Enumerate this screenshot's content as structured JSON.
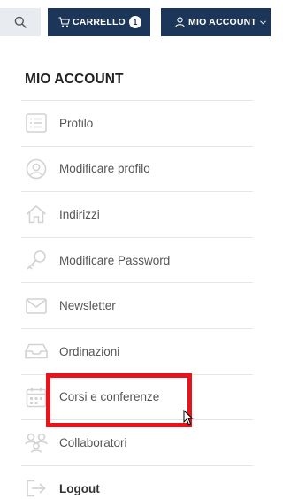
{
  "header": {
    "search_icon": "search-icon",
    "cart": {
      "label": "CARRELLO",
      "count": "1",
      "icon": "cart-icon"
    },
    "account": {
      "label": "MIO ACCOUNT",
      "icon": "user-icon",
      "chevron": "chevron-down-icon"
    }
  },
  "panel": {
    "title": "MIO ACCOUNT",
    "items": [
      {
        "label": "Profilo",
        "icon": "list-icon"
      },
      {
        "label": "Modificare profilo",
        "icon": "user-circle-icon"
      },
      {
        "label": "Indirizzi",
        "icon": "home-icon"
      },
      {
        "label": "Modificare Password",
        "icon": "key-icon"
      },
      {
        "label": "Newsletter",
        "icon": "envelope-icon"
      },
      {
        "label": "Ordinazioni",
        "icon": "inbox-icon"
      },
      {
        "label": "Corsi e conferenze",
        "icon": "calendar-icon"
      },
      {
        "label": "Collaboratori",
        "icon": "users-icon"
      },
      {
        "label": "Logout",
        "icon": "sign-out-icon"
      }
    ]
  },
  "colors": {
    "header_button": "#1c3659",
    "search_bg": "#e8ecf1",
    "highlight": "#e8141c",
    "icon_gray": "#d2d2d2"
  }
}
